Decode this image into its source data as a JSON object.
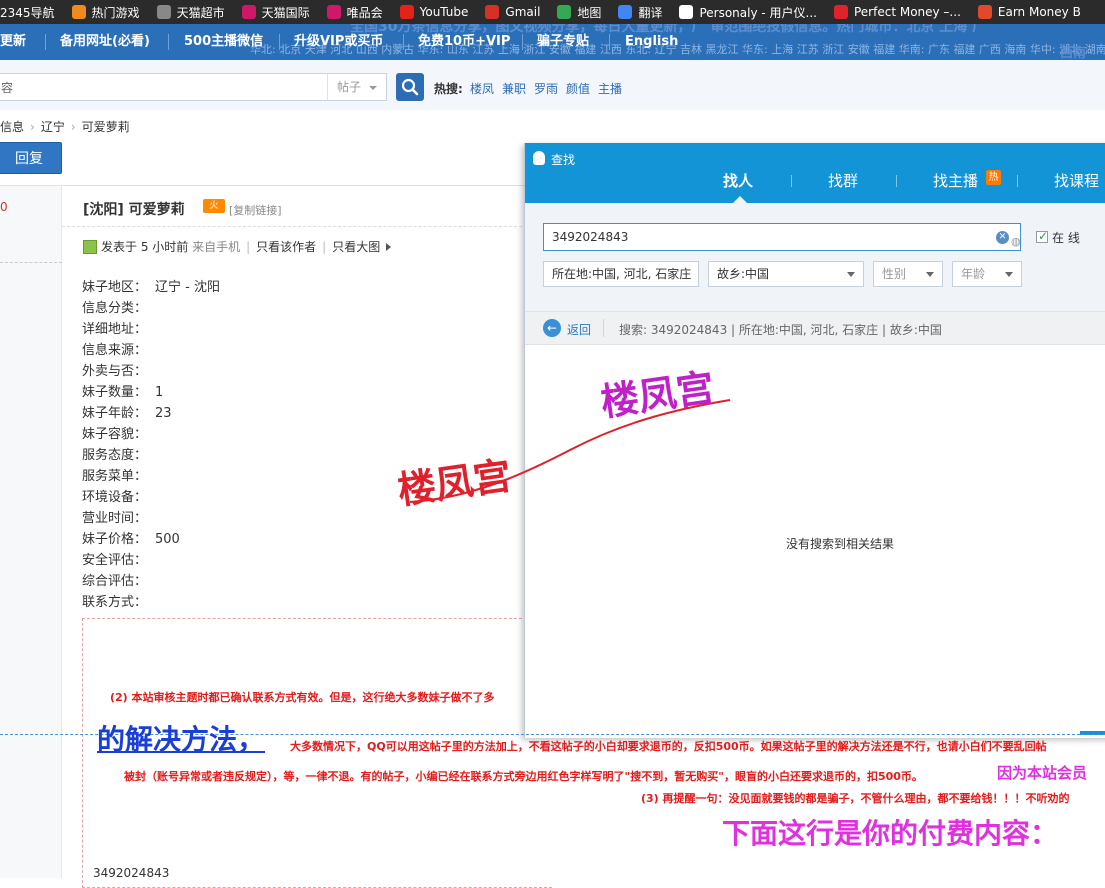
{
  "bookmarks": [
    {
      "label": "2345导航",
      "icon": "none",
      "color": "#2b2b2b"
    },
    {
      "label": "热门游戏",
      "icon": "flame-icon",
      "color": "#f08a1c"
    },
    {
      "label": "天猫超市",
      "icon": "globe-icon",
      "color": "#888888"
    },
    {
      "label": "天猫国际",
      "icon": "tmall-icon",
      "color": "#d0186b"
    },
    {
      "label": "唯品会",
      "icon": "tmall-icon",
      "color": "#d0186b"
    },
    {
      "label": "YouTube",
      "icon": "youtube-icon",
      "color": "#e62117"
    },
    {
      "label": "Gmail",
      "icon": "gmail-icon",
      "color": "#d93025"
    },
    {
      "label": "地图",
      "icon": "maps-icon",
      "color": "#34a853"
    },
    {
      "label": "翻译",
      "icon": "translate-icon",
      "color": "#4285f4"
    },
    {
      "label": "Personaly - 用户仪...",
      "icon": "page-icon",
      "color": "#ffffff"
    },
    {
      "label": "Perfect Money –...",
      "icon": "pm-icon",
      "color": "#e0222a"
    },
    {
      "label": "Earn Money B",
      "icon": "gift-icon",
      "color": "#e04a2a"
    }
  ],
  "sitenav": {
    "items": [
      "更新",
      "备用网址(必看)",
      "500主播微信",
      "升级VIP或买币",
      "免费10币+VIP",
      "骗子专贴",
      "English"
    ],
    "ghost_top": "全国30万条信息分享，图文视频分享，每日大量更新，广 审范围绝技假信息。热门城市：北京 上海 广",
    "ghost_line": "华北: 北京 天津 河北 山西 内蒙古 华东: 山东 江苏 上海 浙江 安徽 福建 江西 东北: 辽宁 吉林 黑龙江 华东: 上海 江苏 浙江 安徽 福建 华南: 广东 福建 广西 海南 华中: 湖北 湖南",
    "ghost_right": "西南"
  },
  "search": {
    "placeholder": "容",
    "type": "帖子",
    "hot_label": "热搜:",
    "hot_links": [
      "楼凤",
      "兼职",
      "罗雨",
      "颜值",
      "主播"
    ]
  },
  "breadcrumb": [
    "信息",
    "辽宁",
    "可爱萝莉"
  ],
  "reply_label": "回复",
  "left_num": "0",
  "post": {
    "title": "[沈阳] 可爱萝莉",
    "fire": "火",
    "copy_link": "[复制链接]",
    "meta_posted": "发表于 5 小时前",
    "meta_source": "来自手机",
    "meta_author": "只看该作者",
    "meta_bigpic": "只看大图",
    "fields": [
      {
        "label": "妹子地区：",
        "value": "辽宁 - 沈阳"
      },
      {
        "label": "信息分类：",
        "value": ""
      },
      {
        "label": "详细地址：",
        "value": ""
      },
      {
        "label": "信息来源：",
        "value": ""
      },
      {
        "label": "外卖与否：",
        "value": ""
      },
      {
        "label": "妹子数量：",
        "value": "1"
      },
      {
        "label": "妹子年龄：",
        "value": "23"
      },
      {
        "label": "妹子容貌：",
        "value": ""
      },
      {
        "label": "服务态度：",
        "value": ""
      },
      {
        "label": "服务菜单：",
        "value": ""
      },
      {
        "label": "环境设备：",
        "value": ""
      },
      {
        "label": "营业时间：",
        "value": ""
      },
      {
        "label": "妹子价格：",
        "value": "500"
      },
      {
        "label": "安全评估：",
        "value": ""
      },
      {
        "label": "综合评估：",
        "value": ""
      },
      {
        "label": "联系方式：",
        "value": ""
      }
    ]
  },
  "qq": {
    "title": "查找",
    "tabs": [
      "找人",
      "找群",
      "找主播",
      "找课程"
    ],
    "hot_badge": "热",
    "input": "3492024843",
    "online_label": "在 线",
    "loc": "所在地:中国, 河北, 石家庄",
    "hometown": "故乡:中国",
    "gender": "性别",
    "age": "年龄",
    "back": "返回",
    "summary": "搜索:  3492024843  |  所在地:中国, 河北, 石家庄  |  故乡:中国",
    "no_result": "没有搜索到相关结果"
  },
  "watermark": {
    "text1": "楼凤宫",
    "text2": "楼凤宫",
    "color1": "#e0202a",
    "color2": "#c020c8"
  },
  "notices": {
    "n2": "(2)  本站审核主题时都已确认联系方式有效。但是，这行绝大多数妹子做不了多",
    "solve": "的解决方法，",
    "n2b": "大多数情况下，QQ可以用这帖子里的方法加上，不看这帖子的小白却要求退币的，反扣500币。如果这帖子里的解决方法还是不行，也请小白们不要乱回帖",
    "n2c": "被封（账号异常或者违反规定），等，一律不退。有的帖子，小编已经在联系方式旁边用红色字样写明了\"搜不到，暂无购买\"，眼盲的小白还要求退币的，扣500币。",
    "member": "因为本站会员",
    "n3": "(3)  再提醒一句：没见面就要钱的都是骗子，不管什么理由，都不要给钱！！！不听劝的",
    "paid": "下面这行是你的付费内容：",
    "footer_qq": "3492024843"
  }
}
